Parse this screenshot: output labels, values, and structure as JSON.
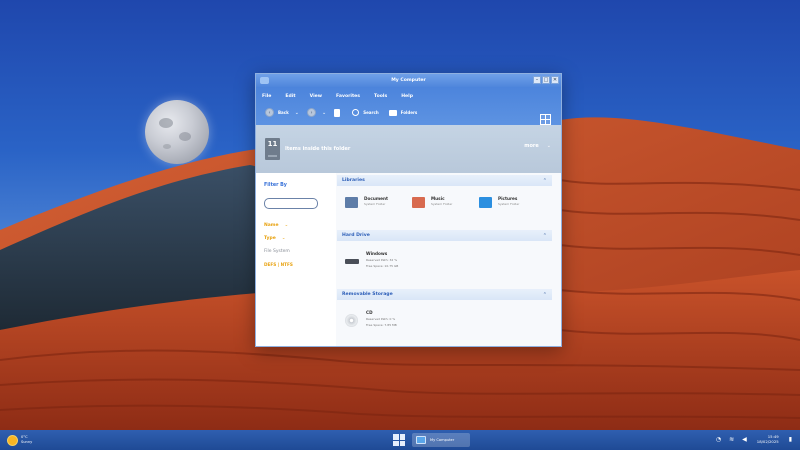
{
  "window": {
    "title": "My Computer",
    "min": "–",
    "max": "□",
    "close": "✕"
  },
  "menu": [
    "File",
    "Edit",
    "View",
    "Favorites",
    "Tools",
    "Help"
  ],
  "toolbar": {
    "back": "Back",
    "search": "Search",
    "folders": "Folders"
  },
  "summary": {
    "count": "11",
    "text": "Items inside this folder",
    "more": "more"
  },
  "sidebar": {
    "filter_by": "Filter By",
    "name": "Name",
    "type": "Type",
    "fs_label": "File System",
    "fs_value": "DEFS | NTFS"
  },
  "sections": {
    "libraries": "Libraries",
    "hard_drives": "Hard Drive",
    "removable": "Removable Storage"
  },
  "libraries": [
    {
      "name": "Document",
      "sub": "System Folder",
      "color": "#5e7da8"
    },
    {
      "name": "Music",
      "sub": "System Folder",
      "color": "#d86a4f"
    },
    {
      "name": "Pictures",
      "sub": "System Folder",
      "color": "#2b8fe0"
    }
  ],
  "drives": {
    "hdd": {
      "name": "Windows",
      "line1": "Reserved Path: 32 %",
      "line2": "Free Space: 10.75 GB"
    },
    "cd": {
      "name": "CD",
      "line1": "Reserved Path: 0 %",
      "line2": "Free Space: 7.85 MB"
    }
  },
  "taskbar": {
    "weather_temp": "0°C",
    "weather_desc": "Sunny",
    "app_label": "My Computer",
    "time": "15:49",
    "date": "18/02/2025"
  }
}
